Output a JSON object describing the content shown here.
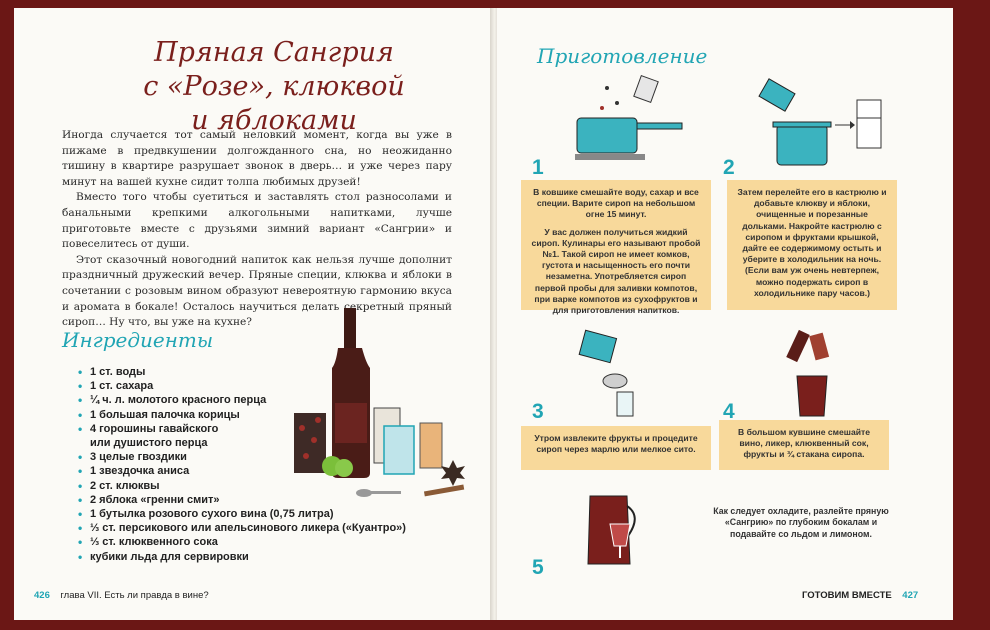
{
  "title": {
    "line1": "Пряная Сангрия",
    "line2": "с «Розе», клюквой",
    "line3": "и яблоками"
  },
  "intro": {
    "p1": "Иногда случается тот самый неловкий момент, когда вы уже в пижаме в предвкушении долгожданного сна, но неожиданно тишину в квартире разрушает звонок в дверь… и уже через пару минут на вашей кухне сидит толпа любимых друзей!",
    "p2": "Вместо того чтобы суетиться и заставлять стол разносолами и банальными крепкими алкогольными напитками, лучше приготовьте вместе с друзьями зимний вариант «Сангрии» и повеселитесь от души.",
    "p3": "Этот сказочный новогодний напиток как нельзя лучше дополнит праздничный дружеский вечер. Пряные специи, клюква и яблоки в сочетании с розовым вином образуют невероятную гармонию вкуса и аромата в бокале! Осталось научиться делать секретный пряный сироп… Ну что, вы уже на кухне?"
  },
  "ingredients_heading": "Ингредиенты",
  "ingredients": [
    "1 ст. воды",
    "1 ст. сахара",
    "¼ ч. л. молотого красного перца",
    "1 большая палочка корицы",
    "4 горошины гавайского",
    "или душистого перца",
    "3 целые гвоздики",
    "1 звездочка аниса",
    "2 ст. клюквы",
    "2 яблока «гренни смит»",
    "1 бутылка розового сухого вина (0,75 литра)",
    "⅓ ст. персикового или апельсинового ликера («Куантро»)",
    "⅓ ст. клюквенного сока",
    "кубики льда для сервировки"
  ],
  "bullet": "•",
  "preparation_heading": "Приготовление",
  "steps": [
    {
      "num": "1",
      "text": "В ковшике смешайте воду, сахар и все специи. Варите сироп на небольшом огне 15 минут.",
      "text2": "У вас должен получиться жидкий сироп. Кулинары его называют пробой №1. Такой сироп не имеет комков, густота и насыщенность его почти незаметна. Употребляется сироп первой пробы для заливки компотов, при варке компотов из сухофруктов и для приготовления напитков."
    },
    {
      "num": "2",
      "text": "Затем перелейте его в кастрюлю и добавьте клюкву и яблоки, очищенные и порезанные дольками. Накройте кастрюлю с сиропом и фруктами крышкой, дайте ее содержимому остыть и уберите в холодильник на ночь. (Если вам уж очень невтерпеж, можно подержать сироп в холодильнике пару часов.)"
    },
    {
      "num": "3",
      "text": "Утром извлеките фрукты и процедите сироп через марлю или мелкое сито."
    },
    {
      "num": "4",
      "text": "В большом кувшине смешайте вино, ликер, клюквенный сок, фрукты и ¾ стакана сиропа."
    },
    {
      "num": "5",
      "text": "Как следует охладите, разлейте пряную «Сангрию» по глубоким бокалам и подавайте со льдом и лимоном."
    }
  ],
  "footer": {
    "left_num": "426",
    "left_chapter": "глава VII. Есть ли правда в вине?",
    "right_label": "ГОТОВИМ ВМЕСТЕ",
    "right_num": "427"
  },
  "colors": {
    "cover": "#6b1715",
    "accent": "#21a5b4",
    "title": "#7a1f1c",
    "note_box": "#f8d99b"
  }
}
